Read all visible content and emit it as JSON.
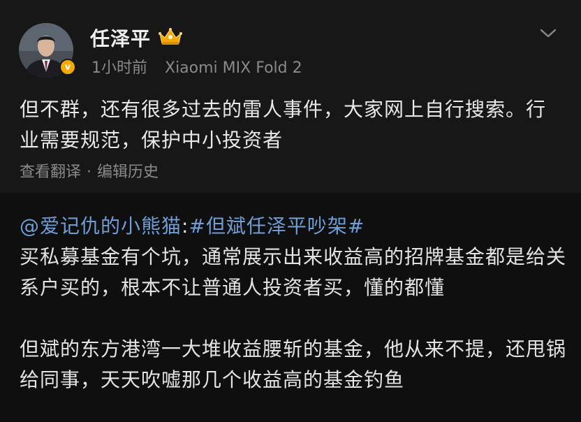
{
  "post": {
    "author": {
      "name": "任泽平",
      "avatar_icon": "person-portrait-icon",
      "verified_icon": "verified-v-badge-icon",
      "verified_badge_text": "v",
      "badge_icon": "crown-badge-icon",
      "badge_color": "#f2a900"
    },
    "time": "1小时前",
    "device": "Xiaomi MIX Fold 2",
    "more_icon": "chevron-down-icon",
    "text": "但不群，还有很多过去的雷人事件，大家网上自行搜索。行业需要规范，保护中小投资者",
    "actions": {
      "translate": "查看翻译",
      "separator": "·",
      "edit_history": "编辑历史"
    }
  },
  "repost": {
    "mention": "@爱记仇的小熊猫",
    "colon": ":",
    "hashtag": "#但斌任泽平吵架#",
    "link_color": "#6e9ed6",
    "paragraph1": "买私募基金有个坑，通常展示出来收益高的招牌基金都是给关系户买的，根本不让普通人投资者买，懂的都懂",
    "paragraph2": "但斌的东方港湾一大堆收益腰斩的基金，他从来不提，还甩锅给同事，天天吹嘘那几个收益高的基金钓鱼"
  }
}
